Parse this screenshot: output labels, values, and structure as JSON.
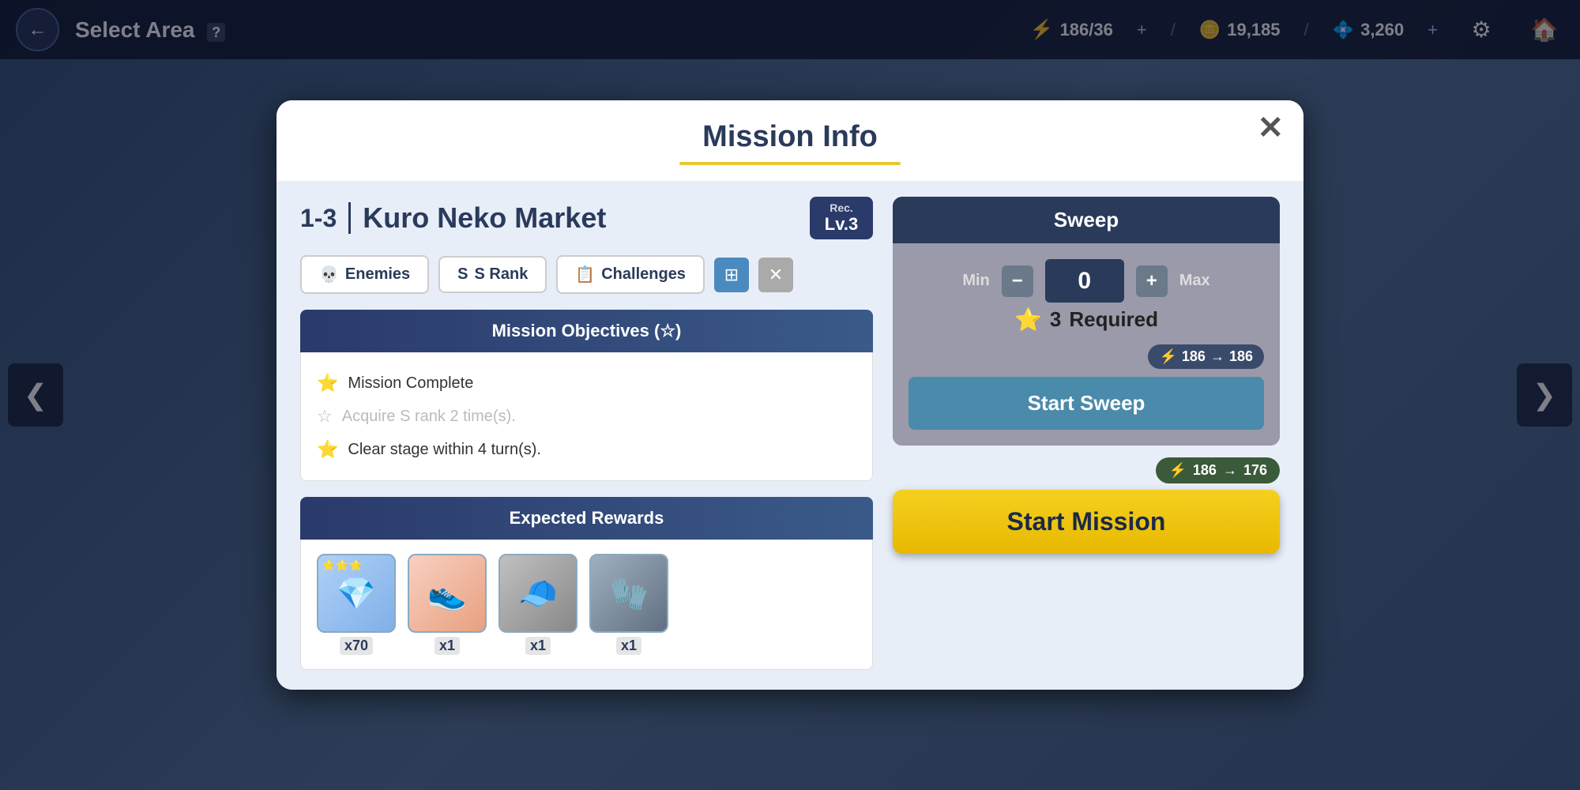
{
  "topbar": {
    "back_label": "←",
    "title": "Select Area",
    "help_label": "?",
    "energy_current": "186",
    "energy_max": "36",
    "energy_display": "186/36",
    "coins": "19,185",
    "gems": "3,260",
    "settings_icon": "⚙",
    "home_icon": "🏠",
    "plus_label": "+"
  },
  "nav": {
    "left_arrow": "❮",
    "right_arrow": "❯"
  },
  "modal": {
    "title": "Mission Info",
    "close_label": "✕",
    "mission_number": "1-3",
    "mission_name": "Kuro Neko Market",
    "rec_label": "Rec.",
    "rec_level": "Lv.3",
    "tabs": [
      {
        "label": "Enemies",
        "icon": "💀"
      },
      {
        "label": "S Rank",
        "icon": "S"
      },
      {
        "label": "Challenges",
        "icon": "📋"
      }
    ],
    "objectives_header": "Mission Objectives (☆)",
    "objectives": [
      {
        "text": "Mission Complete",
        "completed": true
      },
      {
        "text": "Acquire S rank 2 time(s).",
        "completed": false
      },
      {
        "text": "Clear stage within 4 turn(s).",
        "completed": true
      }
    ],
    "rewards_header": "Expected Rewards",
    "rewards": [
      {
        "icon": "💎",
        "count": "x70",
        "stars": "⭐⭐⭐",
        "type": "gem"
      },
      {
        "icon": "👟",
        "count": "x1",
        "stars": "",
        "type": "shoe"
      },
      {
        "icon": "🧢",
        "count": "x1",
        "stars": "",
        "type": "hat"
      },
      {
        "icon": "🧤",
        "count": "x1",
        "stars": "",
        "type": "glove"
      }
    ],
    "sweep": {
      "header": "Sweep",
      "min_label": "Min",
      "max_label": "Max",
      "count": "0",
      "stars_required": "3",
      "required_label": "Required",
      "energy_before": "186",
      "energy_after": "186",
      "energy_arrow": "→",
      "start_sweep_label": "Start Sweep"
    },
    "start_mission": {
      "energy_before": "186",
      "energy_after": "176",
      "energy_arrow": "→",
      "button_label": "Start Mission"
    }
  }
}
